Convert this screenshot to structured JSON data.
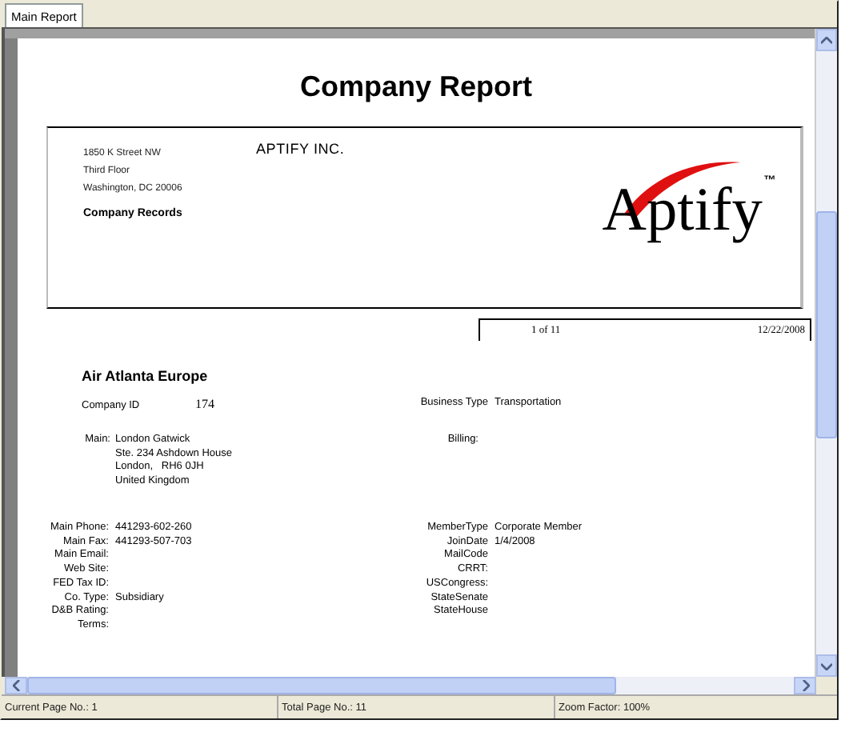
{
  "tabs": [
    {
      "label": "Main Report",
      "selected": true
    }
  ],
  "report": {
    "title": "Company Report",
    "header": {
      "address_lines": [
        "1850 K Street NW",
        "Third Floor",
        "Washington, DC 20006"
      ],
      "section": "Company Records",
      "company": "APTIFY INC.",
      "logo": {
        "word": "Aptify",
        "mark": "™"
      }
    },
    "page_box": {
      "page": "1 of 11",
      "date": "12/22/2008"
    },
    "company_name": "Air Atlanta Europe",
    "id_row": [
      {
        "label": "Company ID",
        "value": "174"
      },
      {
        "label": "Business Type",
        "value": "Transportation"
      }
    ],
    "addresses": [
      {
        "label": "Main:",
        "lines": [
          "London Gatwick",
          "Ste. 234 Ashdown House",
          "London,   RH6 0JH",
          "United Kingdom"
        ]
      },
      {
        "label": "Billing:"
      }
    ],
    "left_fields": [
      {
        "label": "Main Phone:",
        "value": "441293-602-260"
      },
      {
        "label": "Main Fax:",
        "value": "441293-507-703"
      },
      {
        "label": "Main Email:"
      },
      {
        "label": "Web Site:"
      },
      {
        "label": "FED Tax ID:"
      },
      {
        "label": "Co. Type:",
        "value": "Subsidiary"
      },
      {
        "label": "D&B Rating:"
      },
      {
        "label": "Terms:"
      }
    ],
    "right_fields": [
      {
        "label": "MemberType",
        "value": "Corporate Member"
      },
      {
        "label": "JoinDate",
        "value": "1/4/2008"
      },
      {
        "label": "MailCode"
      },
      {
        "label": "CRRT:"
      },
      {
        "label": "USCongress:"
      },
      {
        "label": "StateSenate"
      },
      {
        "label": "StateHouse"
      }
    ]
  },
  "status_bar": [
    "Current Page No.: 1",
    "Total Page No.: 11",
    "Zoom Factor: 100%"
  ]
}
